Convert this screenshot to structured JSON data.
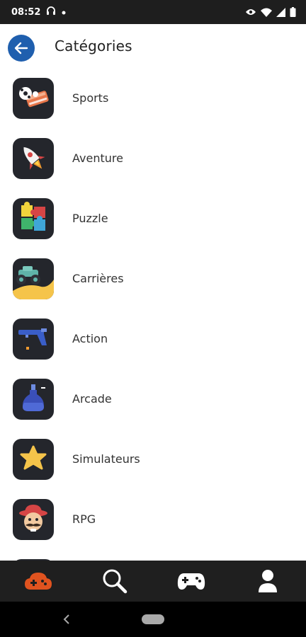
{
  "status_bar": {
    "time": "08:52",
    "icons": [
      "headphones-icon",
      "dot-icon",
      "eye-icon",
      "wifi-icon",
      "signal-icon",
      "battery-icon"
    ]
  },
  "header": {
    "title": "Catégories",
    "back_icon": "arrow-left-icon",
    "accent_color": "#1f5fae"
  },
  "categories": [
    {
      "label": "Sports",
      "icon": "sports-icon"
    },
    {
      "label": "Aventure",
      "icon": "rocket-icon"
    },
    {
      "label": "Puzzle",
      "icon": "puzzle-icon"
    },
    {
      "label": "Carrières",
      "icon": "monster-truck-icon"
    },
    {
      "label": "Action",
      "icon": "blaster-gun-icon"
    },
    {
      "label": "Arcade",
      "icon": "potion-bottle-icon"
    },
    {
      "label": "Simulateurs",
      "icon": "star-icon"
    },
    {
      "label": "RPG",
      "icon": "mustache-character-icon"
    }
  ],
  "bottom_nav": {
    "items": [
      {
        "name": "home",
        "icon": "controller-cloud-icon",
        "active": true
      },
      {
        "name": "search",
        "icon": "search-icon",
        "active": false
      },
      {
        "name": "games",
        "icon": "gamepad-icon",
        "active": false
      },
      {
        "name": "profile",
        "icon": "user-icon",
        "active": false
      }
    ],
    "active_color": "#e0531f",
    "icon_color": "#ffffff"
  }
}
